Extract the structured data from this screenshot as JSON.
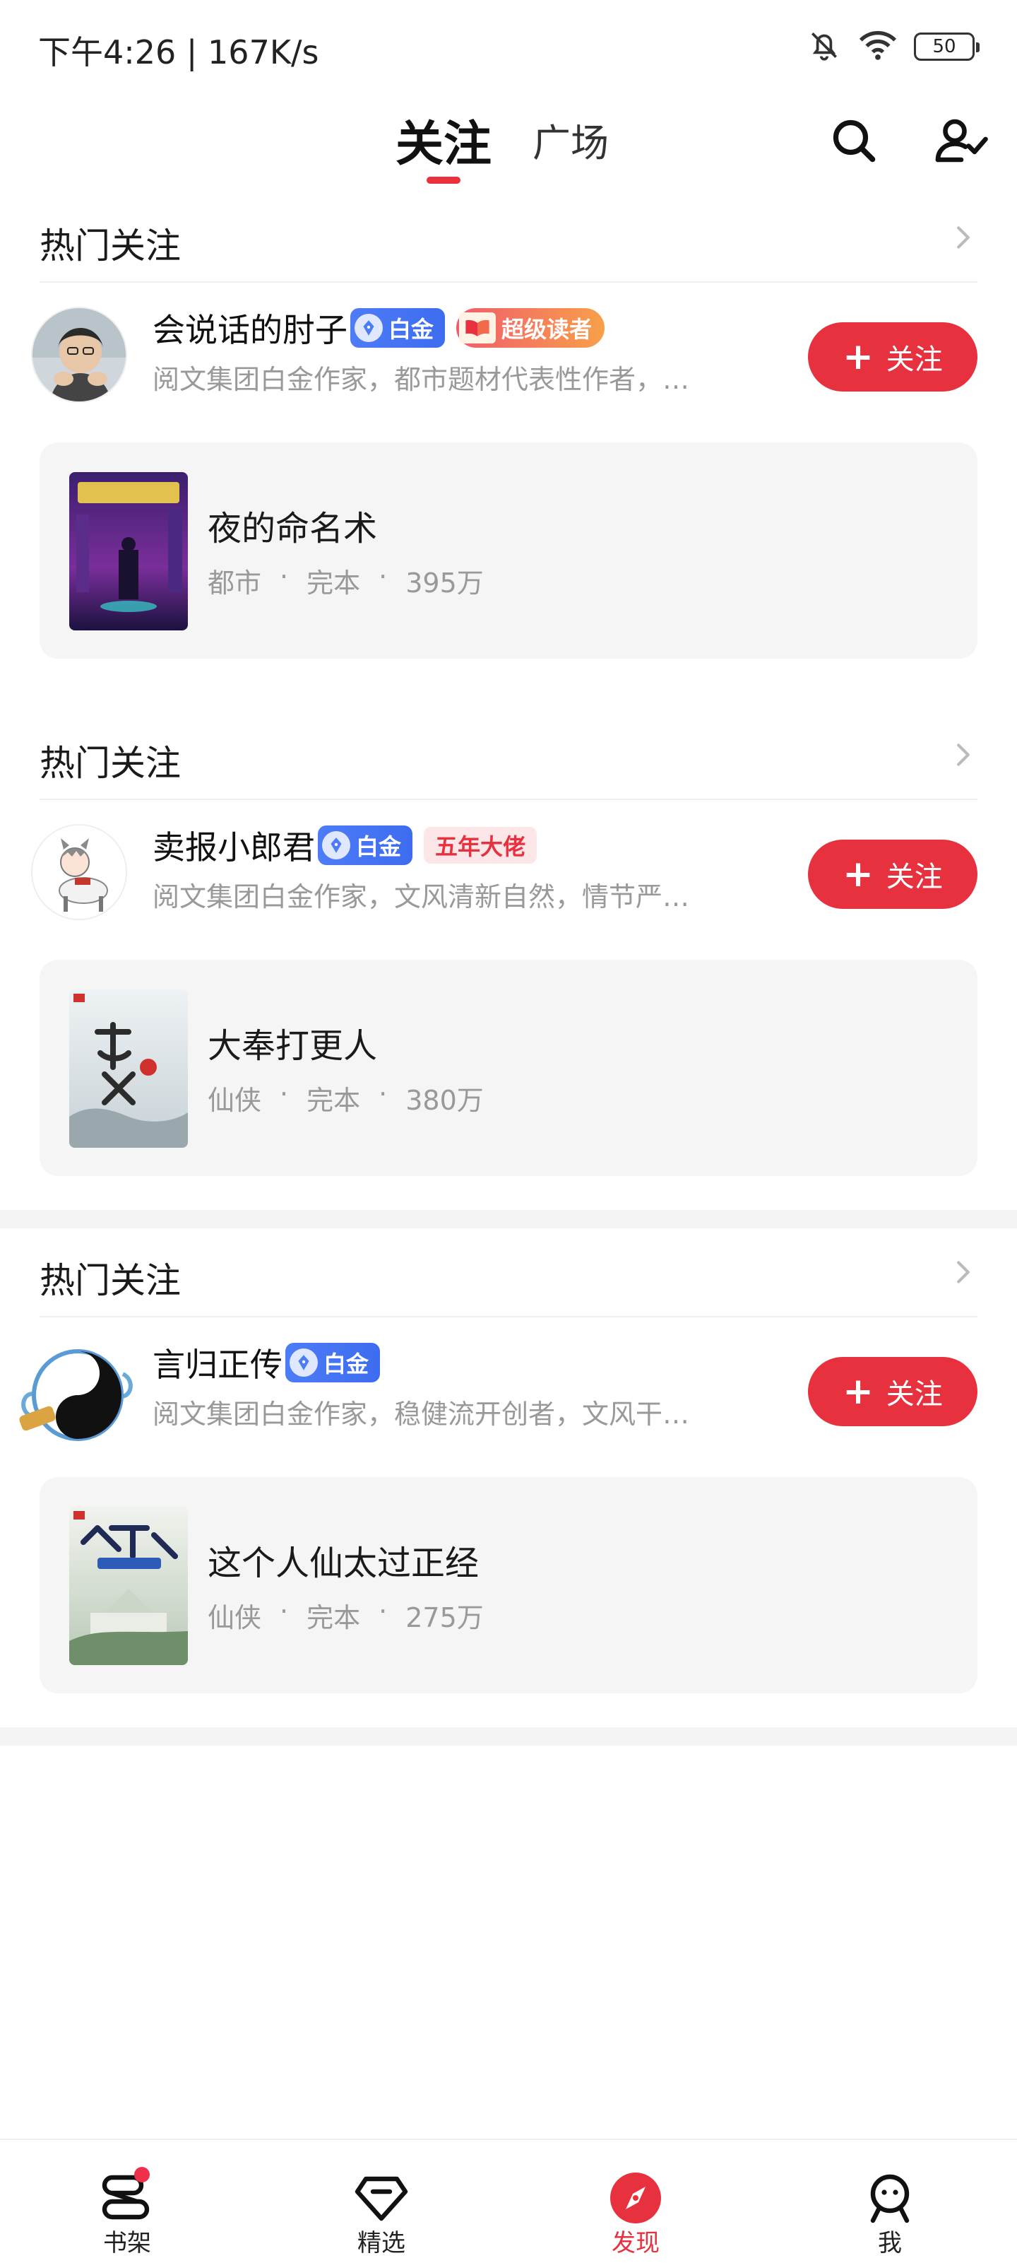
{
  "status_bar": {
    "time": "下午4:26 | 167K/s",
    "battery": "50"
  },
  "top_nav": {
    "tabs": [
      {
        "label": "关注",
        "active": true
      },
      {
        "label": "广场",
        "active": false
      }
    ],
    "search_icon": "search-icon",
    "user_icon": "user-check-icon"
  },
  "sections": [
    {
      "title": "热门关注",
      "author": {
        "name": "会说话的肘子",
        "badges": [
          "白金",
          "超级读者"
        ],
        "desc": "阅文集团白金作家，都市题材代表性作者，…",
        "follow_label": "关注"
      },
      "book": {
        "title": "夜的命名术",
        "genre": "都市",
        "status": "完本",
        "words": "395万"
      }
    },
    {
      "title": "热门关注",
      "author": {
        "name": "卖报小郎君",
        "badges": [
          "白金",
          "五年大佬"
        ],
        "desc": "阅文集团白金作家，文风清新自然，情节严…",
        "follow_label": "关注"
      },
      "book": {
        "title": "大奉打更人",
        "genre": "仙侠",
        "status": "完本",
        "words": "380万"
      }
    },
    {
      "title": "热门关注",
      "author": {
        "name": "言归正传",
        "badges": [
          "白金"
        ],
        "desc": "阅文集团白金作家，稳健流开创者，文风干…",
        "follow_label": "关注"
      },
      "book": {
        "title": "这个人仙太过正经",
        "genre": "仙侠",
        "status": "完本",
        "words": "275万"
      }
    }
  ],
  "bottom_nav": [
    {
      "label": "书架",
      "icon": "bookshelf-icon",
      "active": false,
      "dot": true
    },
    {
      "label": "精选",
      "icon": "diamond-icon",
      "active": false,
      "dot": false
    },
    {
      "label": "发现",
      "icon": "compass-icon",
      "active": true,
      "dot": false
    },
    {
      "label": "我",
      "icon": "profile-icon",
      "active": false,
      "dot": false
    }
  ],
  "colors": {
    "accent": "#e8313e",
    "platinum_badge": "#4d7cf7",
    "muted_text": "#999999",
    "card_bg": "#f5f5f5"
  }
}
